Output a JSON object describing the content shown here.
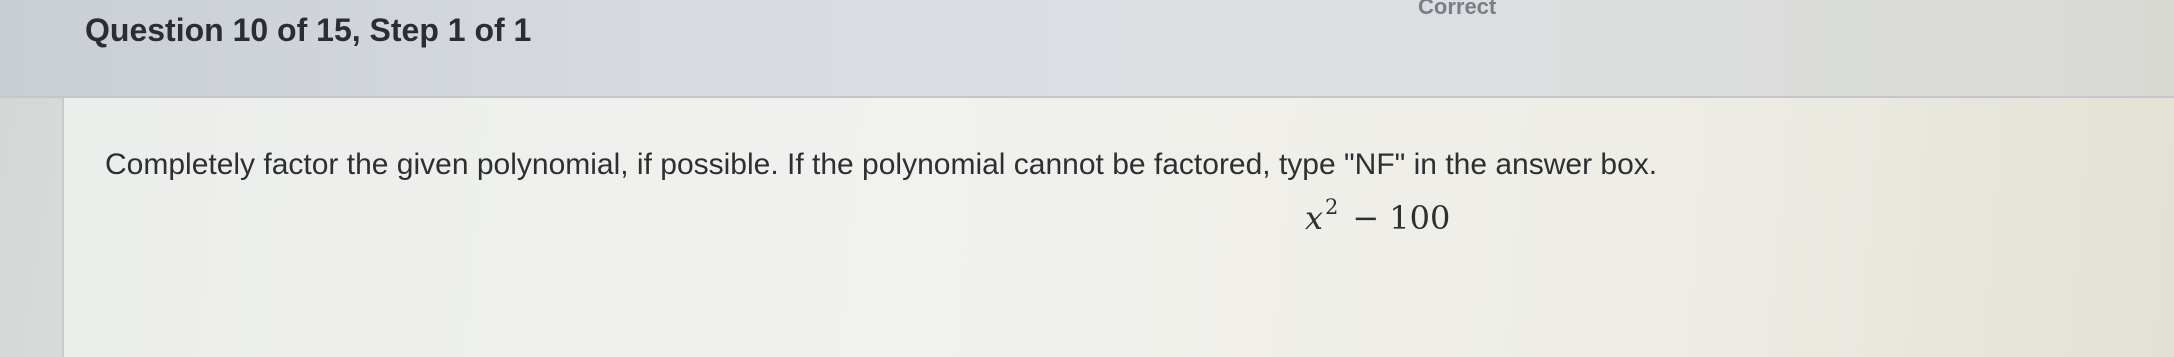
{
  "header": {
    "title": "Question 10 of 15, Step 1 of 1",
    "status": "Correct"
  },
  "question": {
    "prompt": "Completely factor the given polynomial, if possible. If the polynomial cannot be factored, type \"NF\" in the answer box.",
    "expression": {
      "variable": "x",
      "exponent": "2",
      "operator": "−",
      "constant": "100"
    }
  }
}
